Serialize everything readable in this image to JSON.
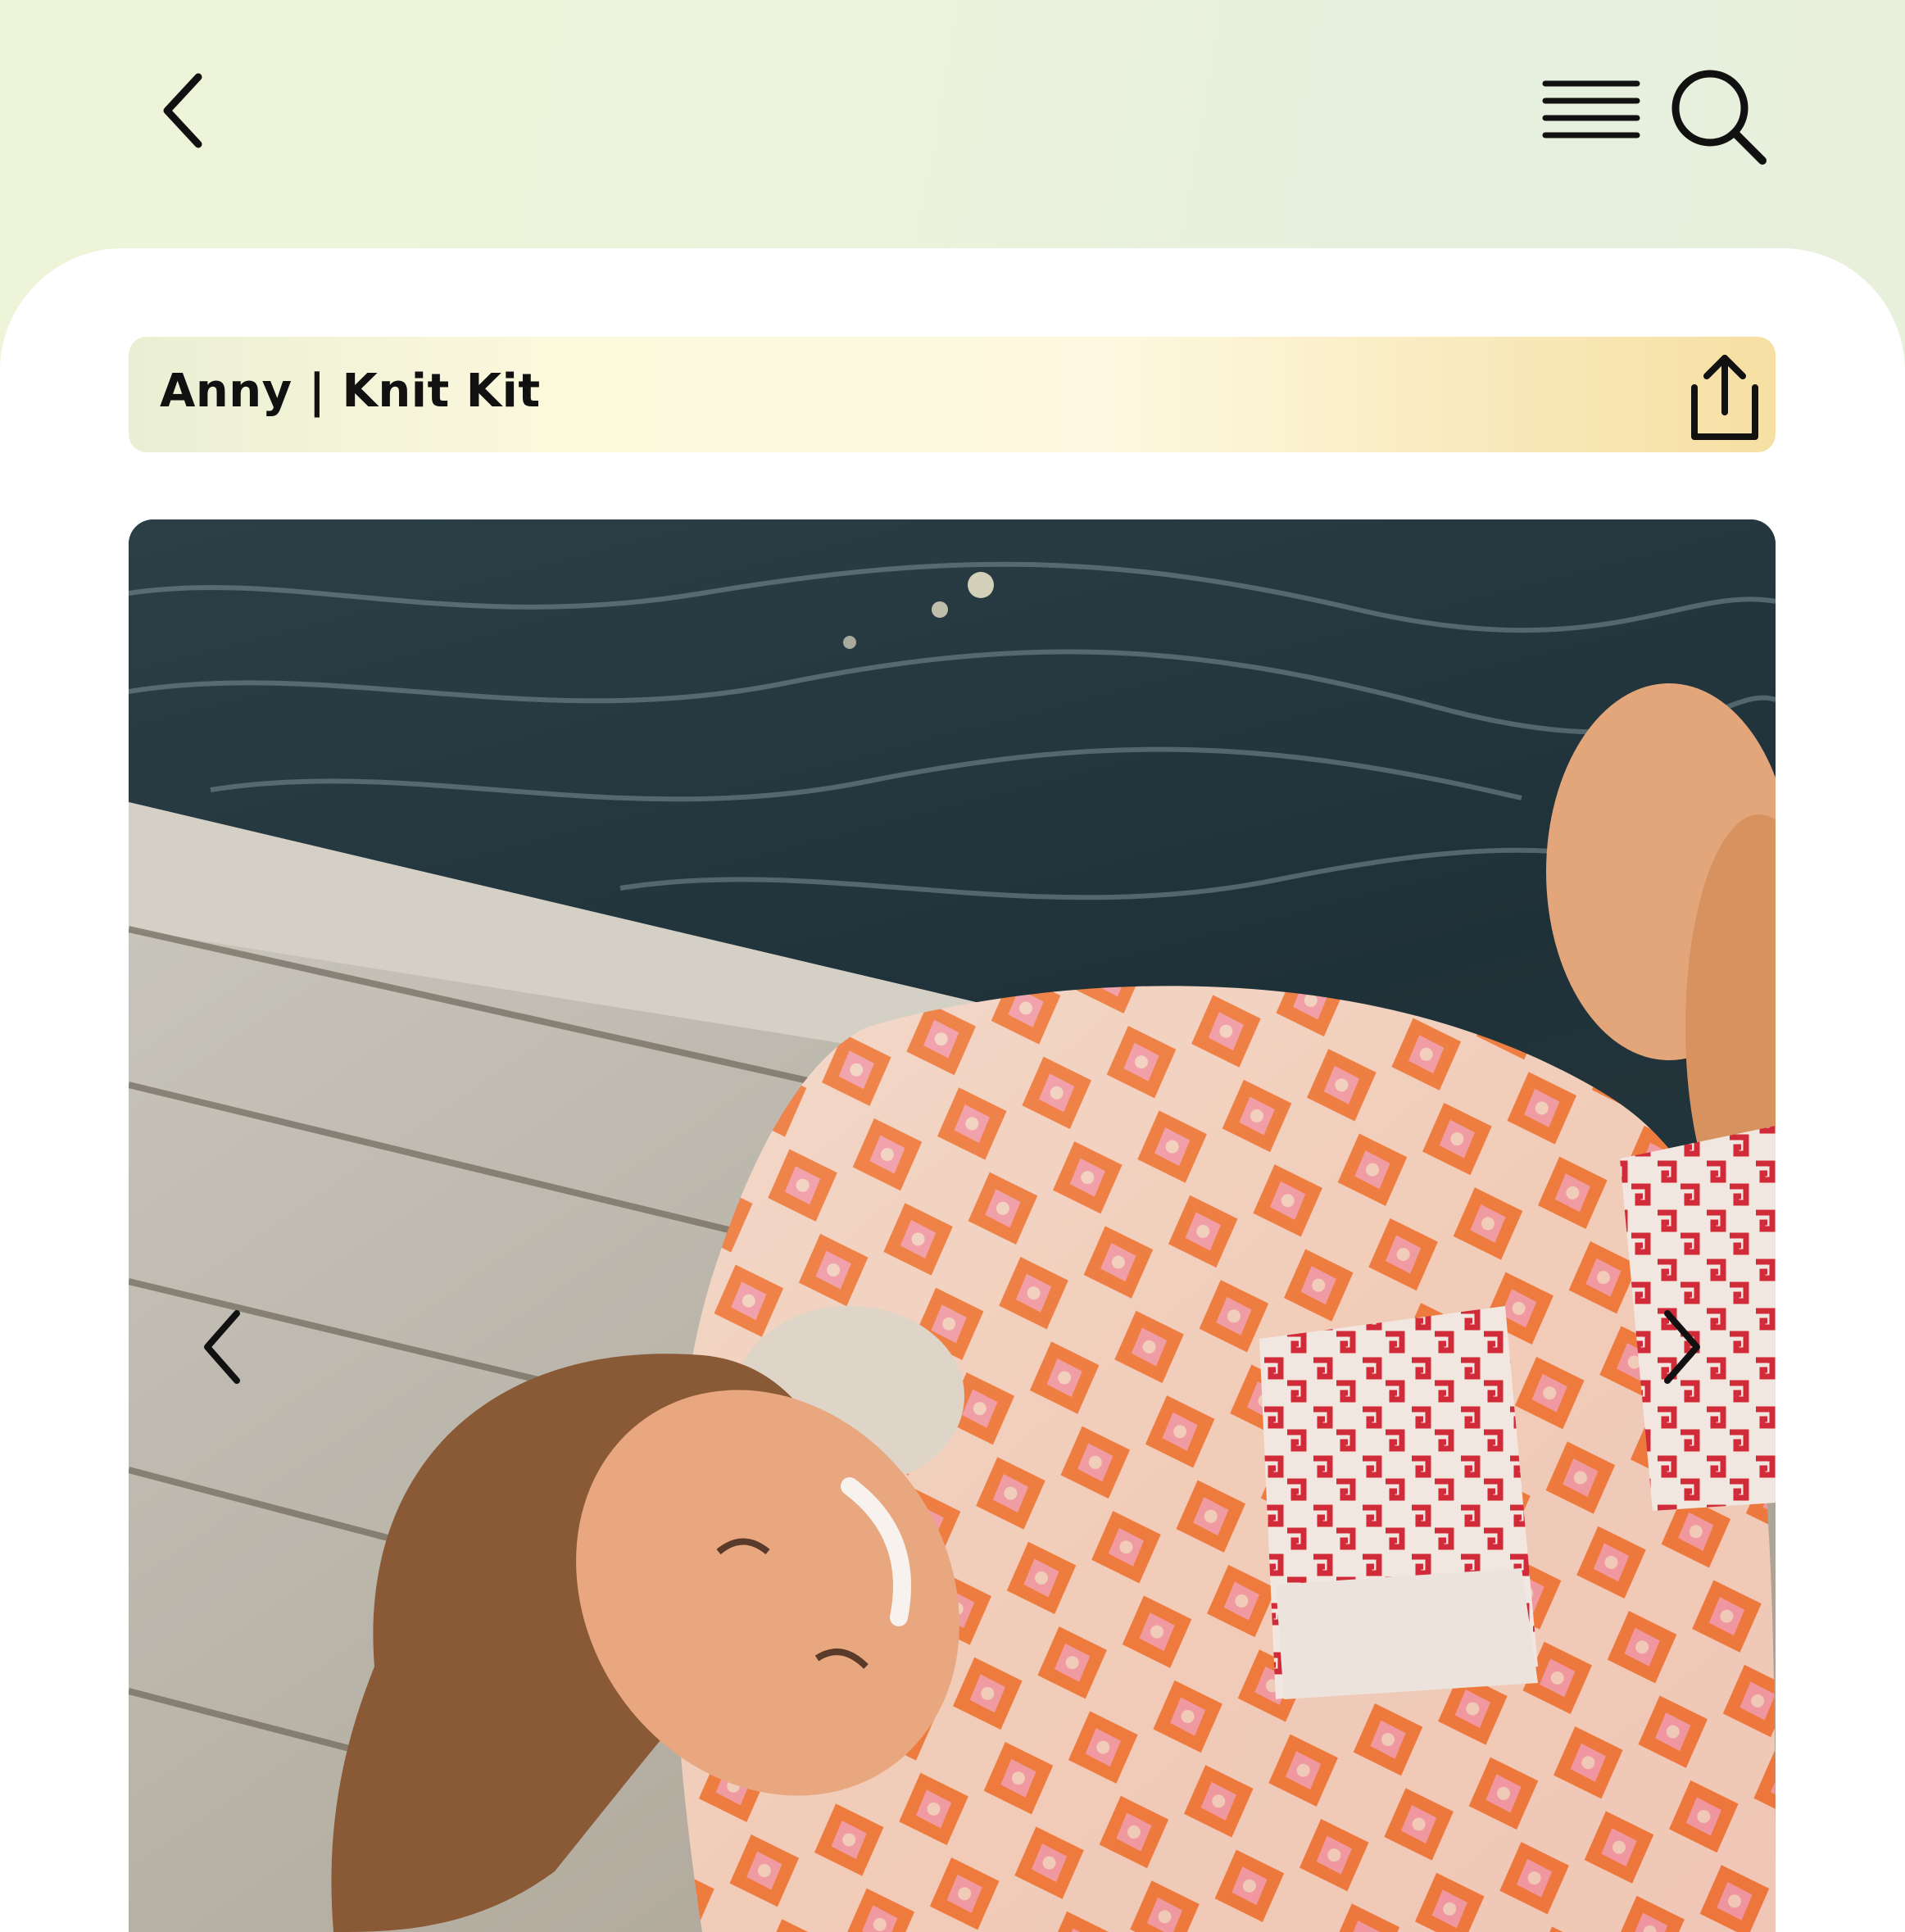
{
  "header": {
    "back_icon": "chevron-left-icon",
    "menu_icon": "hamburger-menu-icon",
    "search_icon": "search-icon"
  },
  "product": {
    "title": "Anny | Knit Kit",
    "share_icon": "share-icon"
  },
  "gallery": {
    "prev_icon": "chevron-left-icon",
    "next_icon": "chevron-right-icon"
  },
  "colors": {
    "background_mint": "#e6f0df",
    "title_bar_start": "#eaefd3",
    "title_bar_end": "#f6dfa2",
    "text": "#111111"
  }
}
